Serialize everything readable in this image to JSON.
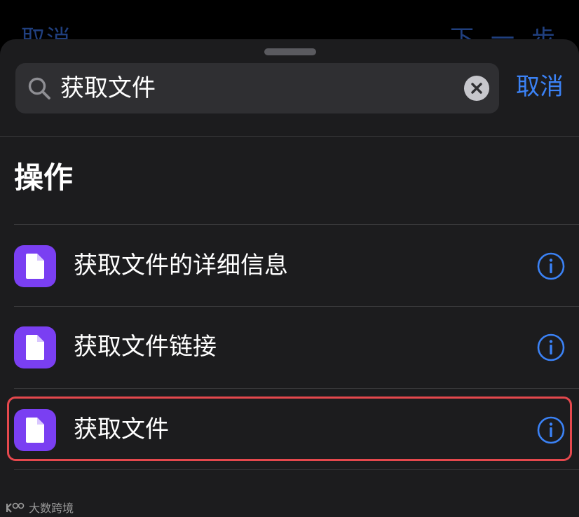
{
  "background_header": {
    "left_label": "取消",
    "right_label": "下一步"
  },
  "search": {
    "value": "获取文件",
    "cancel_label": "取消"
  },
  "section": {
    "title": "操作"
  },
  "actions": [
    {
      "label": "获取文件的详细信息",
      "icon": "document-icon",
      "highlighted": false
    },
    {
      "label": "获取文件链接",
      "icon": "document-icon",
      "highlighted": false
    },
    {
      "label": "获取文件",
      "icon": "document-icon",
      "highlighted": true
    }
  ],
  "watermark": "大数跨境",
  "colors": {
    "sheet_background": "#1c1c1e",
    "accent": "#3b82f6",
    "app_icon": "#7a3ff2",
    "highlight": "#e5484d"
  }
}
